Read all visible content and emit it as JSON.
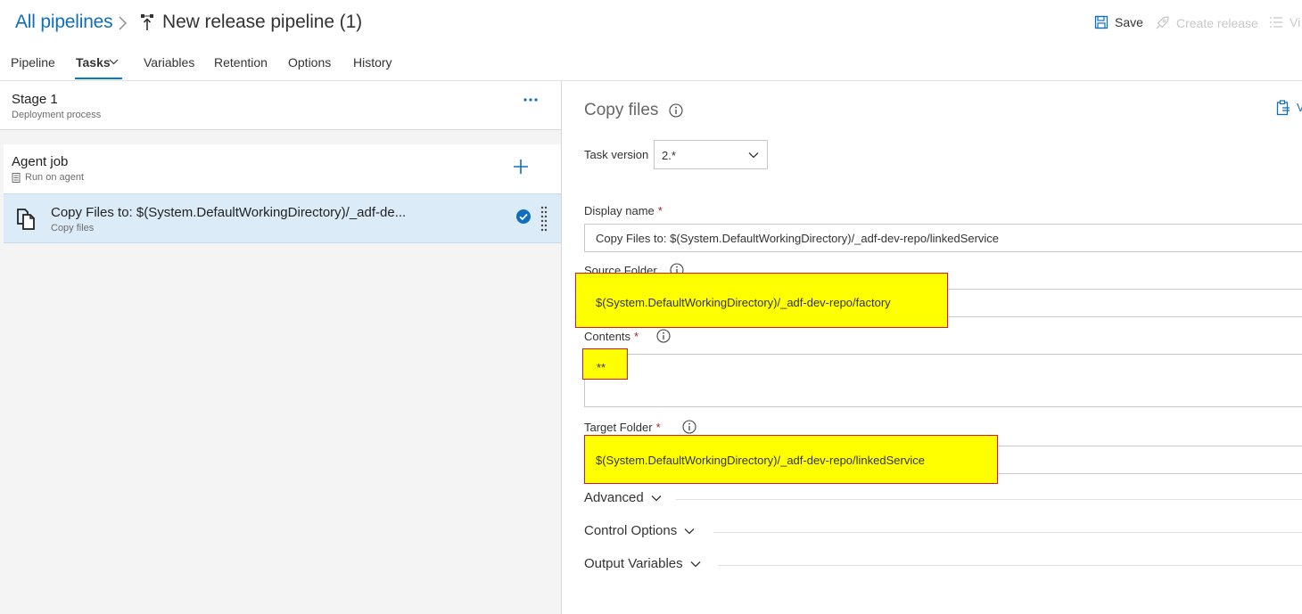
{
  "header": {
    "breadcrumb_root": "All pipelines",
    "pipeline_title": "New release pipeline (1)",
    "save_label": "Save",
    "create_release_label": "Create release",
    "view_label": "Vi"
  },
  "tabs": [
    {
      "label": "Pipeline"
    },
    {
      "label": "Tasks"
    },
    {
      "label": "Variables"
    },
    {
      "label": "Retention"
    },
    {
      "label": "Options"
    },
    {
      "label": "History"
    }
  ],
  "stage": {
    "name": "Stage 1",
    "subtitle": "Deployment process"
  },
  "agent_job": {
    "name": "Agent job",
    "subtitle": "Run on agent"
  },
  "task_item": {
    "name": "Copy Files to: $(System.DefaultWorkingDirectory)/_adf-de...",
    "subtitle": "Copy files"
  },
  "task_panel": {
    "title": "Copy files",
    "view_yaml_label": "V",
    "task_version_label": "Task version",
    "task_version_value": "2.*",
    "display_name_label": "Display name",
    "display_name_value": "Copy Files to: $(System.DefaultWorkingDirectory)/_adf-dev-repo/linkedService",
    "source_folder_label": "Source Folder",
    "source_folder_value": "$(System.DefaultWorkingDirectory)/_adf-dev-repo/factory",
    "contents_label": "Contents",
    "contents_value": "**",
    "target_folder_label": "Target Folder",
    "target_folder_value": "$(System.DefaultWorkingDirectory)/_adf-dev-repo/linkedService",
    "required_marker": "*",
    "sections": [
      {
        "label": "Advanced"
      },
      {
        "label": "Control Options"
      },
      {
        "label": "Output Variables"
      }
    ]
  },
  "colors": {
    "accent": "#0078d4",
    "highlight": "#ffff00",
    "highlight_border": "#e81123"
  }
}
